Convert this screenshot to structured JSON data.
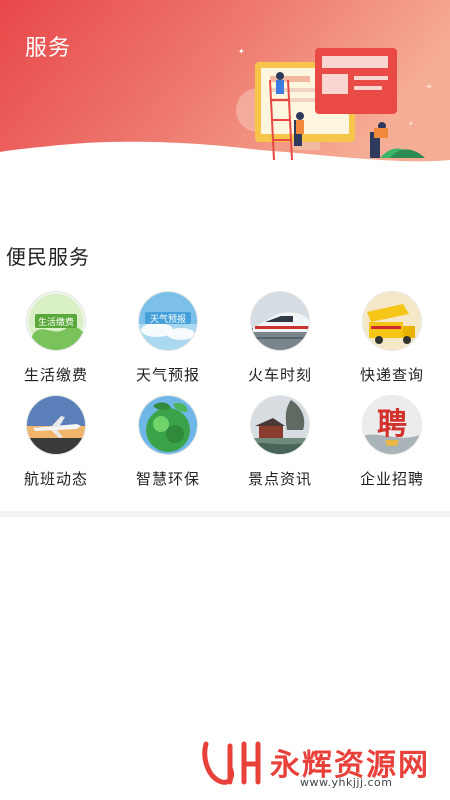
{
  "header": {
    "title": "服务"
  },
  "section": {
    "title": "便民服务"
  },
  "services": [
    {
      "label": "生活缴费",
      "icon": "bill-payment-icon",
      "badge_text": "生活缴费"
    },
    {
      "label": "天气预报",
      "icon": "weather-forecast-icon",
      "badge_text": "天气预报"
    },
    {
      "label": "火车时刻",
      "icon": "train-icon"
    },
    {
      "label": "快递查询",
      "icon": "delivery-truck-icon"
    },
    {
      "label": "航班动态",
      "icon": "airplane-icon"
    },
    {
      "label": "智慧环保",
      "icon": "green-earth-icon"
    },
    {
      "label": "景点资讯",
      "icon": "scenic-spot-icon"
    },
    {
      "label": "企业招聘",
      "icon": "recruitment-icon",
      "badge_text": "聘"
    }
  ],
  "watermark": {
    "brand": "永辉资源网",
    "url": "www.yhkjjj.com"
  },
  "colors": {
    "header_start": "#e8474a",
    "header_end": "#f5a88e",
    "accent": "#e8403a"
  }
}
